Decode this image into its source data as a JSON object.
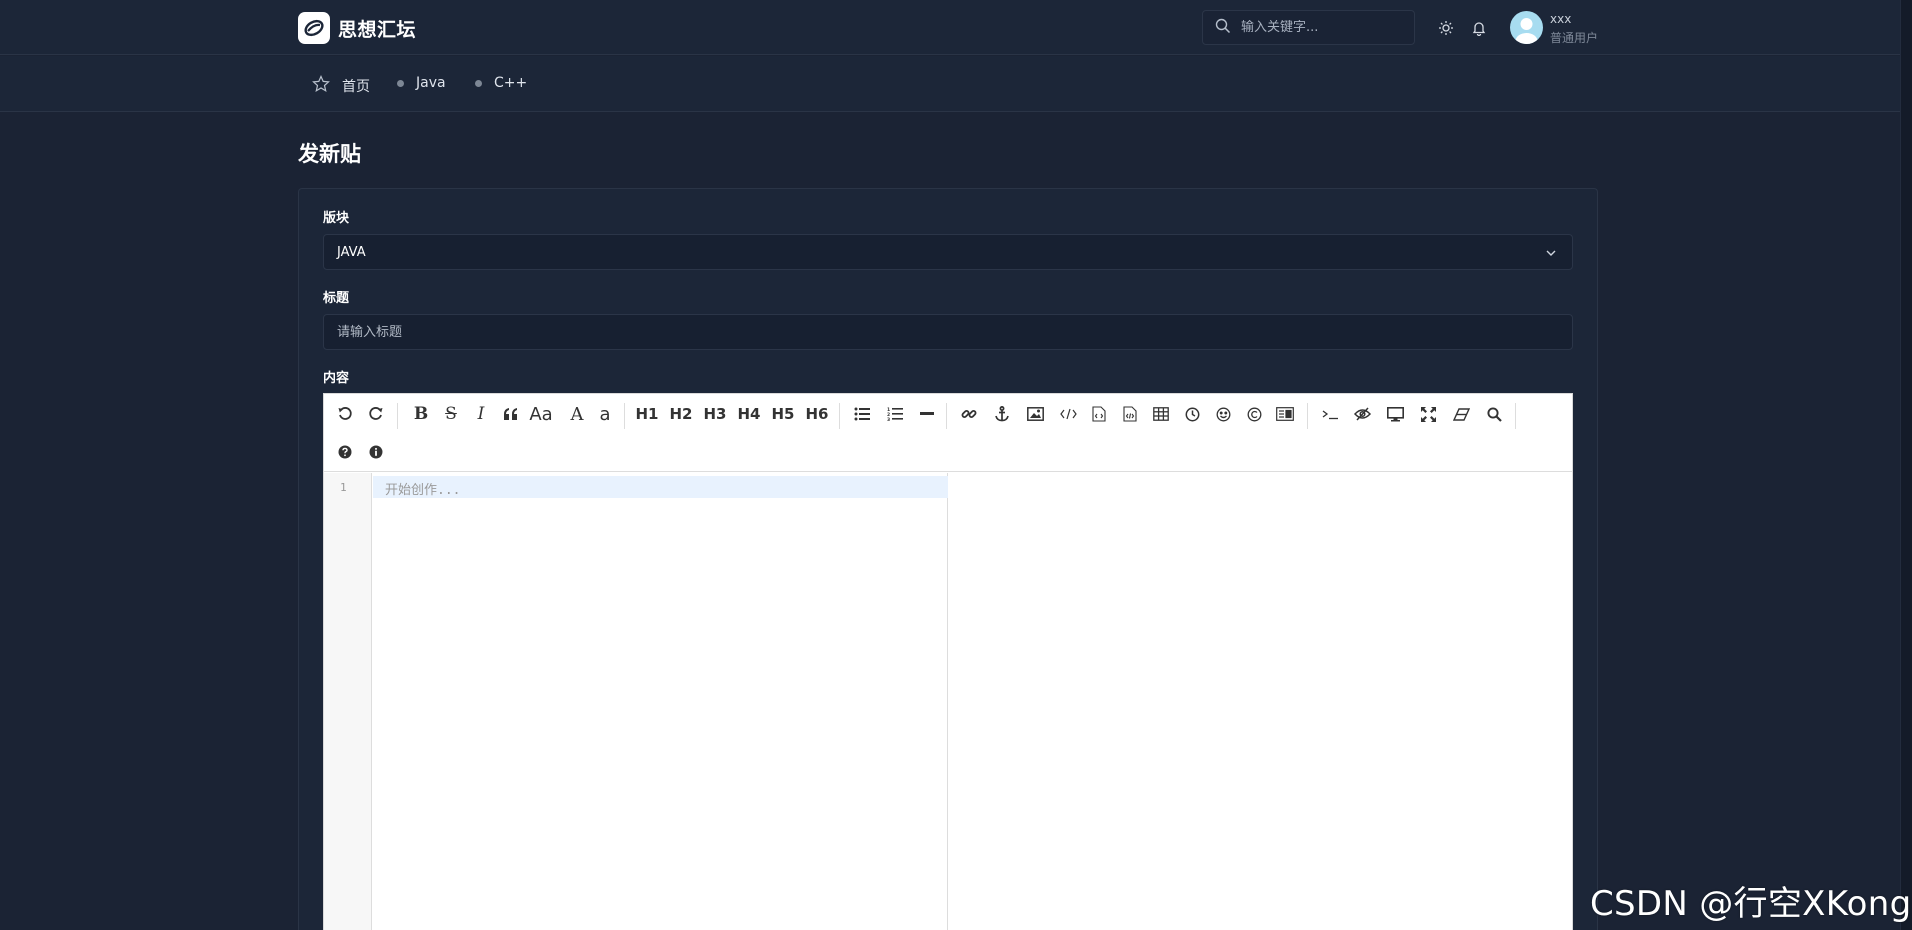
{
  "header": {
    "logo_text": "思想汇坛",
    "search_placeholder": "输入关键字...",
    "user_name": "xxx",
    "user_role": "普通用户"
  },
  "nav": {
    "items": [
      {
        "label": "首页",
        "icon": "star-icon"
      },
      {
        "label": "Java",
        "icon": "dot"
      },
      {
        "label": "C++",
        "icon": "dot"
      }
    ]
  },
  "page": {
    "title": "发新贴"
  },
  "form": {
    "board_label": "版块",
    "board_value": "JAVA",
    "title_label": "标题",
    "title_placeholder": "请输入标题",
    "content_label": "内容"
  },
  "editor": {
    "headings": [
      "H1",
      "H2",
      "H3",
      "H4",
      "H5",
      "H6"
    ],
    "case_labels": {
      "aa": "Aa",
      "upper": "A",
      "lower": "a"
    },
    "line_number": "1",
    "placeholder": "开始创作..."
  },
  "watermark": "CSDN @行空XKong",
  "colors": {
    "background": "#1b2334",
    "panel": "#1c2638",
    "input_bg": "#172031",
    "border": "#2a3446"
  }
}
